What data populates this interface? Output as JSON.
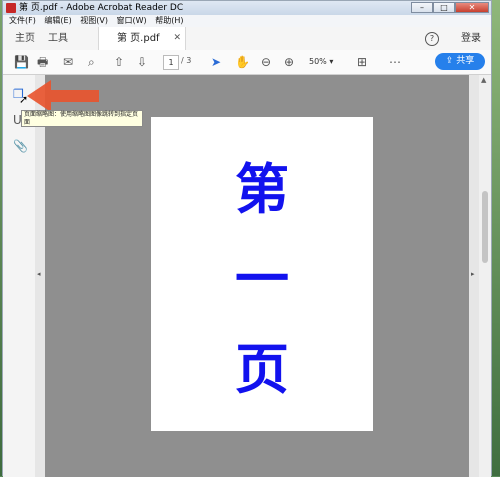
{
  "titlebar": {
    "title": "第 页.pdf - Adobe Acrobat Reader DC"
  },
  "menu": [
    "文件(F)",
    "编辑(E)",
    "视图(V)",
    "窗口(W)",
    "帮助(H)"
  ],
  "tabs": {
    "home": "主页",
    "tools": "工具",
    "doc": "第 页.pdf"
  },
  "account": {
    "login": "登录"
  },
  "toolbar": {
    "page_current": "1",
    "page_total": "/ 3",
    "zoom": "50%",
    "share": "共享"
  },
  "tooltip": {
    "text": "页面缩略图：使用缩略图图像跳转到指定页面"
  },
  "page_content": {
    "chars": [
      "第",
      "一",
      "页"
    ]
  },
  "colors": {
    "share_button": "#2680eb",
    "page_text": "#1212ee",
    "arrow": "#e8552f"
  }
}
